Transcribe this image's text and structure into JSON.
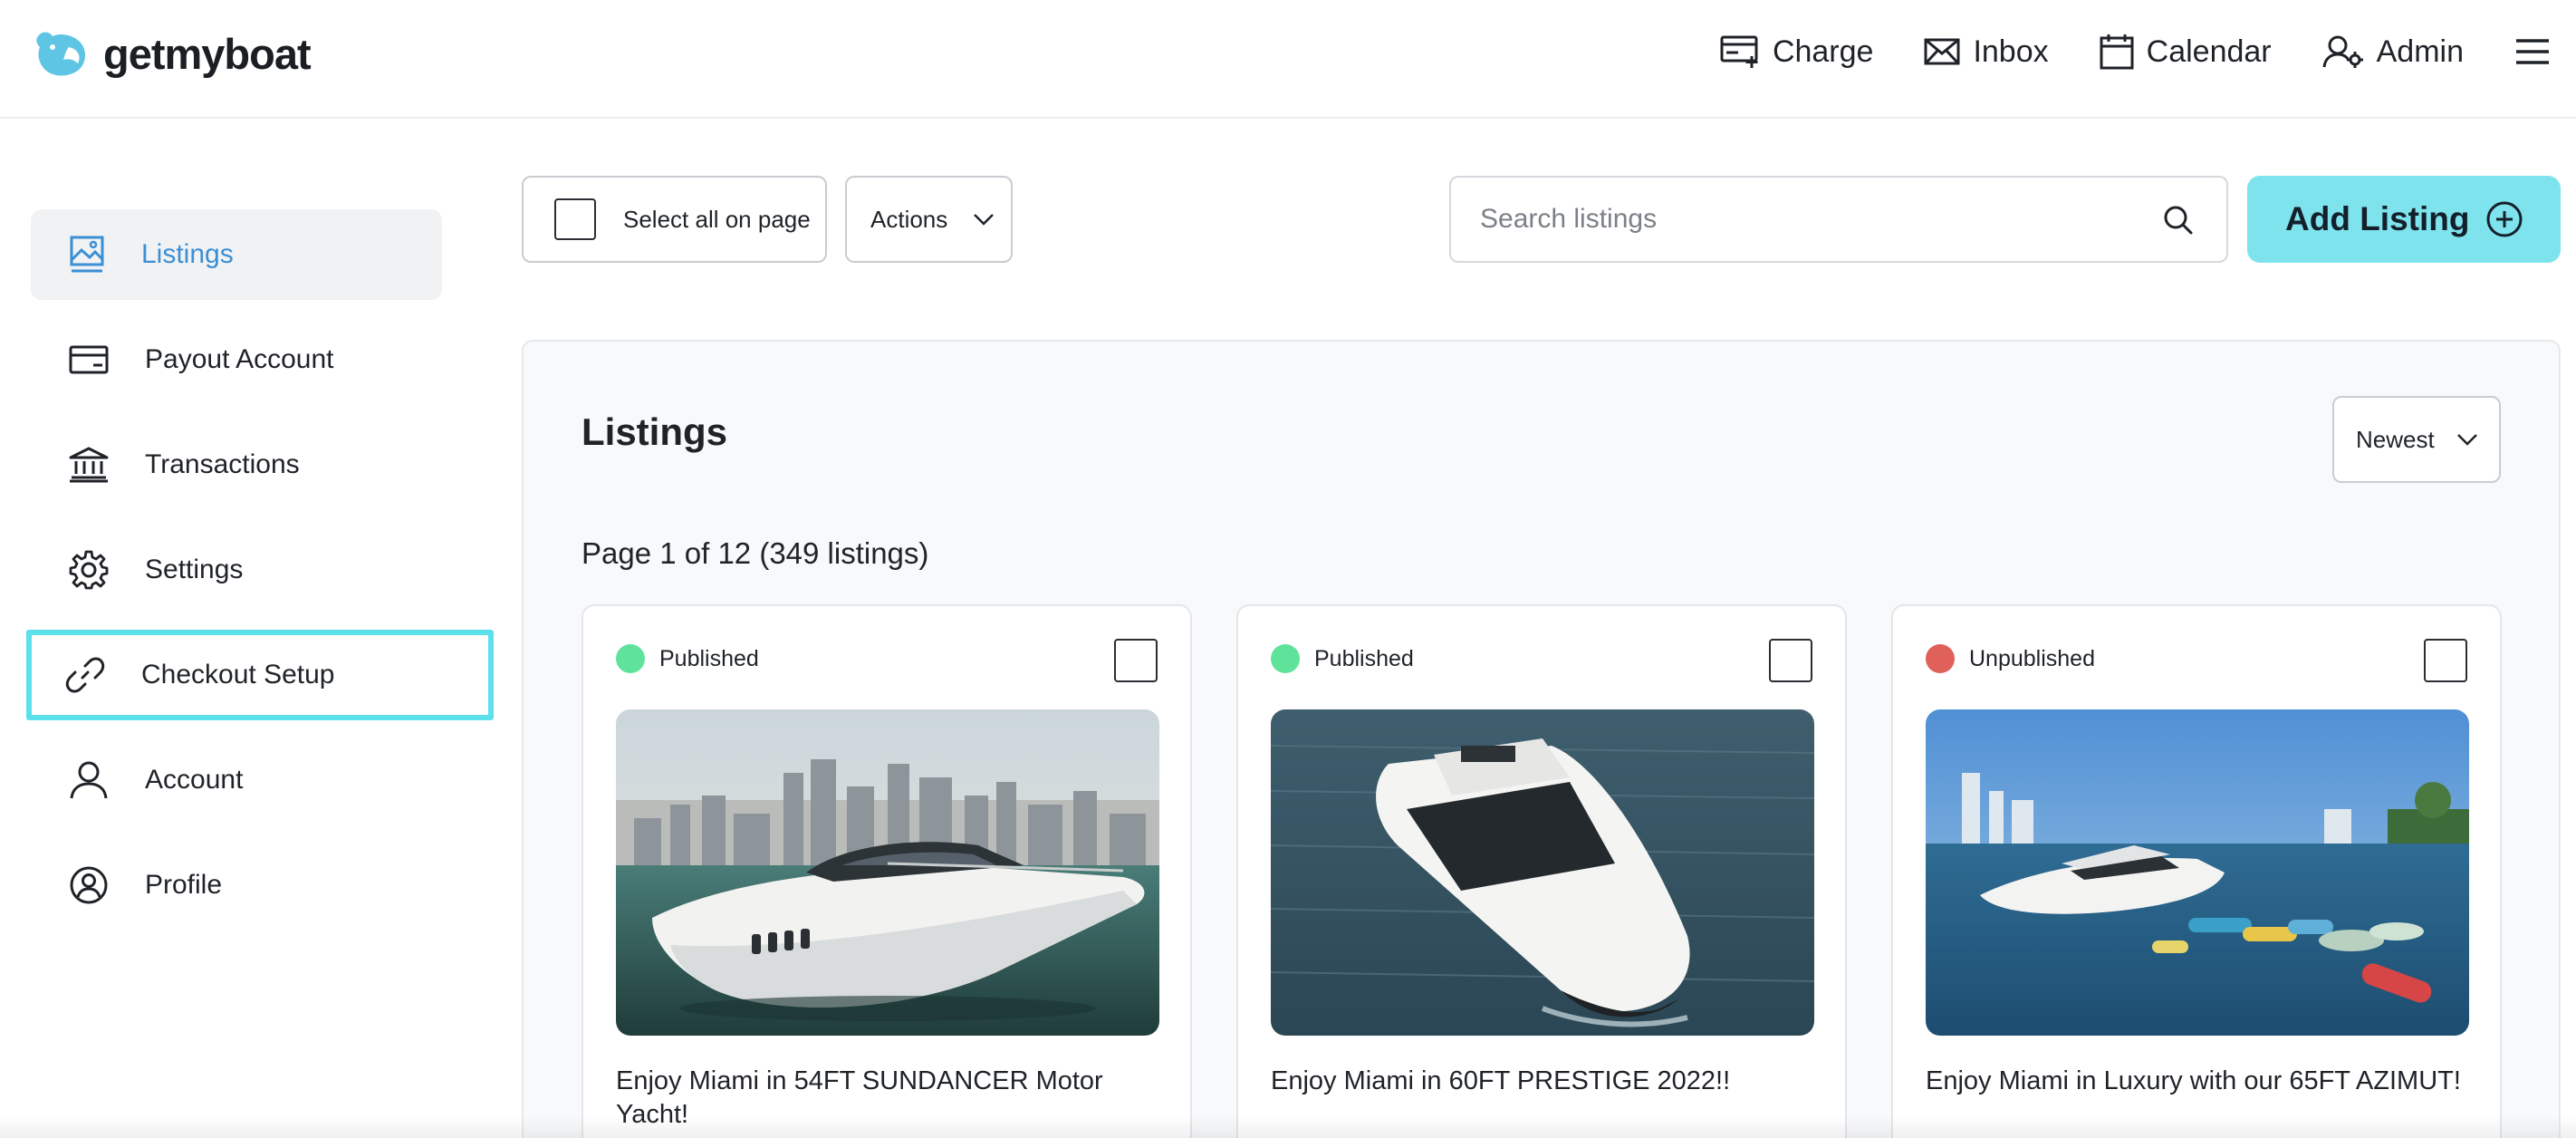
{
  "app": {
    "logo_text": "getmyboat"
  },
  "nav": {
    "charge": "Charge",
    "inbox": "Inbox",
    "calendar": "Calendar",
    "admin": "Admin"
  },
  "sidebar": {
    "items": [
      {
        "label": "Listings",
        "icon": "image-icon"
      },
      {
        "label": "Payout Account",
        "icon": "credit-card-icon"
      },
      {
        "label": "Transactions",
        "icon": "bank-icon"
      },
      {
        "label": "Settings",
        "icon": "gear-icon"
      },
      {
        "label": "Checkout Setup",
        "icon": "link-icon"
      },
      {
        "label": "Account",
        "icon": "user-icon"
      },
      {
        "label": "Profile",
        "icon": "user-circle-icon"
      }
    ]
  },
  "toolbar": {
    "select_all_label": "Select all on page",
    "actions_label": "Actions",
    "search_placeholder": "Search listings",
    "add_listing_label": "Add Listing"
  },
  "listings": {
    "heading": "Listings",
    "sort_label": "Newest",
    "page_info": "Page 1 of 12 (349 listings)",
    "cards": [
      {
        "status": "Published",
        "status_color": "#5fe39a",
        "title": "Enjoy Miami in 54FT SUNDANCER Motor Yacht!"
      },
      {
        "status": "Published",
        "status_color": "#5fe39a",
        "title": "Enjoy Miami in 60FT PRESTIGE 2022!!"
      },
      {
        "status": "Unpublished",
        "status_color": "#e0605a",
        "title": "Enjoy Miami in Luxury with our 65FT AZIMUT!"
      }
    ]
  },
  "colors": {
    "accent": "#3b8fd3",
    "brand_cyan": "#7ee3ec",
    "focus_ring": "#5ce0ec"
  }
}
